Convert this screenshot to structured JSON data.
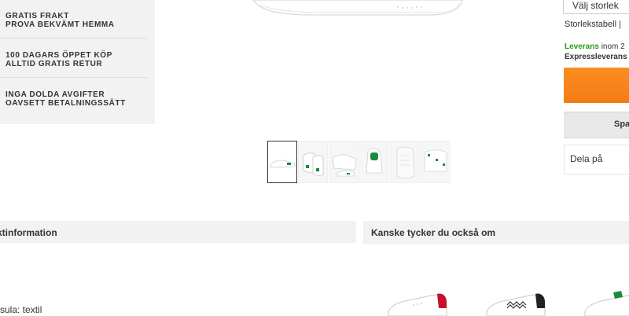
{
  "promo": {
    "items": [
      {
        "line1": "GRATIS FRAKT",
        "line2": "PROVA BEKVÄMT HEMMA"
      },
      {
        "line1": "100 DAGARS ÖPPET KÖP",
        "line2": "ALLTID GRATIS RETUR"
      },
      {
        "line1": "INGA DOLDA AVGIFTER",
        "line2": "OAVSETT BETALNINGSSÄTT"
      }
    ]
  },
  "product": {
    "size_select_label": "Välj storlek",
    "size_table_link": "Storlekstabell |",
    "delivery_label": "Leverans",
    "delivery_text": " inom 2",
    "express_label": "Expressleverans",
    "wish_button_label": "Spa",
    "share_label": "Dela på"
  },
  "thumbnails": {
    "count": 6,
    "active_index": 0,
    "icons": [
      "shoe-side-thumb",
      "shoe-pair-thumb",
      "shoe-top-thumb",
      "shoe-heel-thumb",
      "shoe-sole-thumb",
      "shoe-detail-thumb"
    ]
  },
  "sections": {
    "product_info_title": "ktinformation",
    "recommendations_title": "Kanske tycker du också om"
  },
  "product_info": {
    "material_line": "sula: textil"
  },
  "recommendations": {
    "items": [
      {
        "icon": "sneaker-red-heel-icon",
        "accent": "#c8102e"
      },
      {
        "icon": "sneaker-zigzag-icon",
        "accent": "#222222"
      },
      {
        "icon": "sneaker-green-icon",
        "accent": "#1c8a3a"
      }
    ]
  },
  "colors": {
    "buy_button": "#f47b15",
    "delivery_green": "#2a9b1b",
    "panel_bg": "#f2f2f2"
  }
}
